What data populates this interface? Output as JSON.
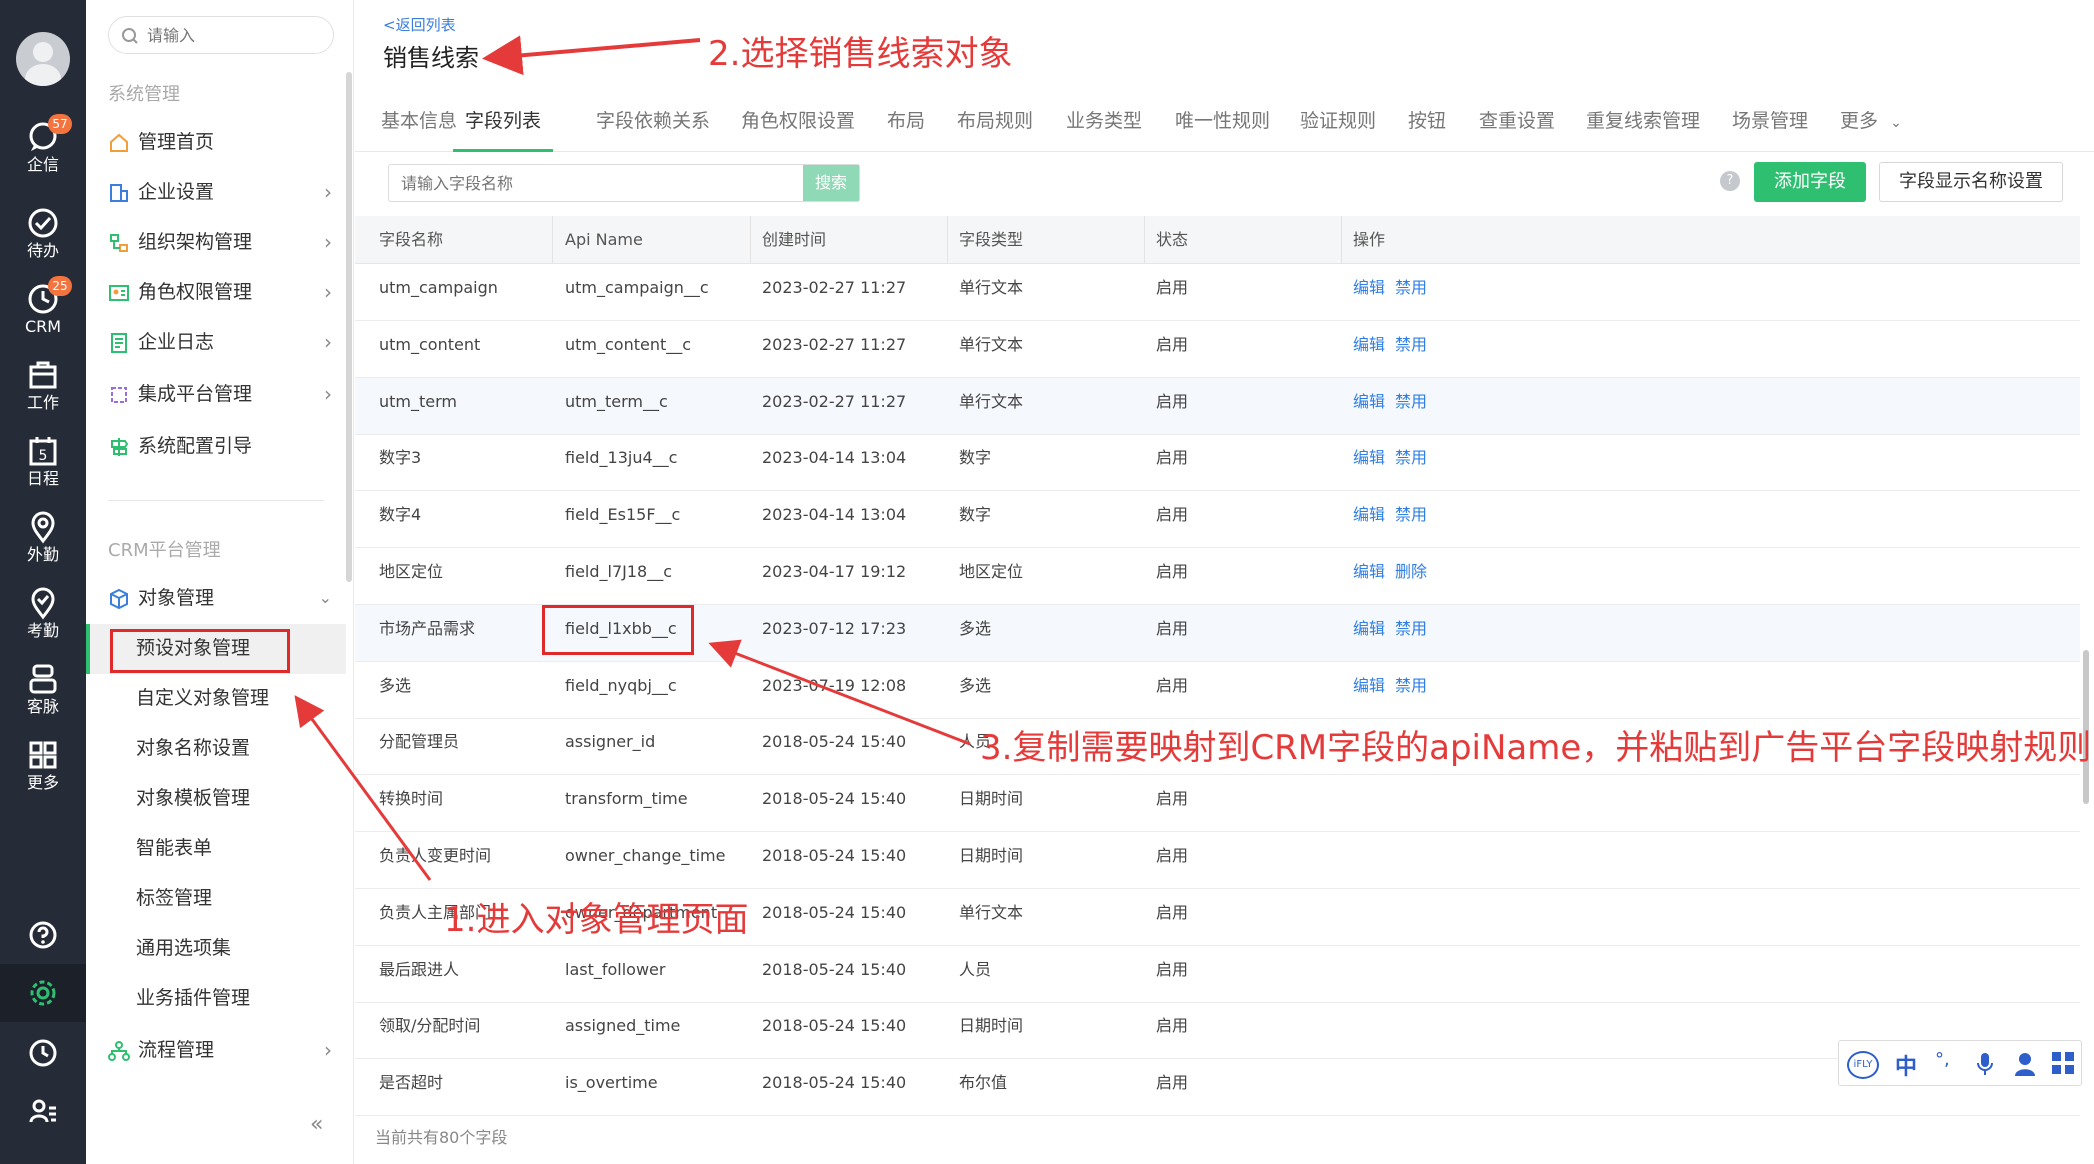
{
  "rail": {
    "items": [
      {
        "label": "企信",
        "icon": "chat-icon",
        "badge": "57"
      },
      {
        "label": "待办",
        "icon": "check-circle-icon",
        "badge": ""
      },
      {
        "label": "CRM",
        "icon": "crm-clock-icon",
        "badge": "25"
      },
      {
        "label": "工作",
        "icon": "briefcase-icon",
        "badge": ""
      },
      {
        "label": "日程",
        "icon": "calendar-icon",
        "badge": ""
      },
      {
        "label": "外勤",
        "icon": "location-icon",
        "badge": ""
      },
      {
        "label": "考勤",
        "icon": "attendance-icon",
        "badge": ""
      },
      {
        "label": "客脉",
        "icon": "contacts-icon",
        "badge": ""
      },
      {
        "label": "更多",
        "icon": "grid-icon",
        "badge": ""
      }
    ],
    "bottom": [
      "help-icon",
      "settings-icon",
      "history-icon",
      "user-list-icon"
    ]
  },
  "menu": {
    "search_placeholder": "请输入",
    "group_system": "系统管理",
    "system_items": [
      {
        "label": "管理首页",
        "icon": "home-icon",
        "arrow": ""
      },
      {
        "label": "企业设置",
        "icon": "enterprise-icon",
        "arrow": "›"
      },
      {
        "label": "组织架构管理",
        "icon": "org-icon",
        "arrow": "›"
      },
      {
        "label": "角色权限管理",
        "icon": "role-icon",
        "arrow": "›"
      },
      {
        "label": "企业日志",
        "icon": "log-icon",
        "arrow": "›"
      },
      {
        "label": "集成平台管理",
        "icon": "integration-icon",
        "arrow": "›"
      },
      {
        "label": "系统配置引导",
        "icon": "guide-icon",
        "arrow": ""
      }
    ],
    "group_crm": "CRM平台管理",
    "object_mgmt": "对象管理",
    "object_sub": [
      "预设对象管理",
      "自定义对象管理",
      "对象名称设置",
      "对象模板管理",
      "智能表单",
      "标签管理",
      "通用选项集",
      "业务插件管理"
    ],
    "process_mgmt": "流程管理",
    "collapse": "«"
  },
  "page": {
    "back": "<返回列表",
    "title": "销售线索",
    "tabs": [
      "基本信息",
      "字段列表",
      "字段依赖关系",
      "角色权限设置",
      "布局",
      "布局规则",
      "业务类型",
      "唯一性规则",
      "验证规则",
      "按钮",
      "查重设置",
      "重复线索管理",
      "场景管理",
      "更多"
    ],
    "active_tab": "字段列表",
    "search_placeholder": "请输入字段名称",
    "search_button": "搜索",
    "help": "?",
    "add_button": "添加字段",
    "name_setting_button": "字段显示名称设置",
    "footer": "当前共有80个字段"
  },
  "table": {
    "columns": [
      "字段名称",
      "Api Name",
      "创建时间",
      "字段类型",
      "状态",
      "操作"
    ],
    "rows": [
      {
        "name": "utm_campaign",
        "api": "utm_campaign__c",
        "time": "2023-02-27 11:27",
        "type": "单行文本",
        "status": "启用",
        "op1": "编辑",
        "op2": "禁用"
      },
      {
        "name": "utm_content",
        "api": "utm_content__c",
        "time": "2023-02-27 11:27",
        "type": "单行文本",
        "status": "启用",
        "op1": "编辑",
        "op2": "禁用"
      },
      {
        "name": "utm_term",
        "api": "utm_term__c",
        "time": "2023-02-27 11:27",
        "type": "单行文本",
        "status": "启用",
        "op1": "编辑",
        "op2": "禁用"
      },
      {
        "name": "数字3",
        "api": "field_13ju4__c",
        "time": "2023-04-14 13:04",
        "type": "数字",
        "status": "启用",
        "op1": "编辑",
        "op2": "禁用"
      },
      {
        "name": "数字4",
        "api": "field_Es15F__c",
        "time": "2023-04-14 13:04",
        "type": "数字",
        "status": "启用",
        "op1": "编辑",
        "op2": "禁用"
      },
      {
        "name": "地区定位",
        "api": "field_l7J18__c",
        "time": "2023-04-17 19:12",
        "type": "地区定位",
        "status": "启用",
        "op1": "编辑",
        "op2": "删除"
      },
      {
        "name": "市场产品需求",
        "api": "field_l1xbb__c",
        "time": "2023-07-12 17:23",
        "type": "多选",
        "status": "启用",
        "op1": "编辑",
        "op2": "禁用"
      },
      {
        "name": "多选",
        "api": "field_nyqbj__c",
        "time": "2023-07-19 12:08",
        "type": "多选",
        "status": "启用",
        "op1": "编辑",
        "op2": "禁用"
      },
      {
        "name": "分配管理员",
        "api": "assigner_id",
        "time": "2018-05-24 15:40",
        "type": "人员",
        "status": "",
        "op1": "",
        "op2": ""
      },
      {
        "name": "转换时间",
        "api": "transform_time",
        "time": "2018-05-24 15:40",
        "type": "日期时间",
        "status": "启用",
        "op1": "",
        "op2": ""
      },
      {
        "name": "负责人变更时间",
        "api": "owner_change_time",
        "time": "2018-05-24 15:40",
        "type": "日期时间",
        "status": "启用",
        "op1": "",
        "op2": ""
      },
      {
        "name": "负责人主属部门",
        "api": "owner_department",
        "time": "2018-05-24 15:40",
        "type": "单行文本",
        "status": "启用",
        "op1": "",
        "op2": ""
      },
      {
        "name": "最后跟进人",
        "api": "last_follower",
        "time": "2018-05-24 15:40",
        "type": "人员",
        "status": "启用",
        "op1": "",
        "op2": ""
      },
      {
        "name": "领取/分配时间",
        "api": "assigned_time",
        "time": "2018-05-24 15:40",
        "type": "日期时间",
        "status": "启用",
        "op1": "",
        "op2": ""
      },
      {
        "name": "是否超时",
        "api": "is_overtime",
        "time": "2018-05-24 15:40",
        "type": "布尔值",
        "status": "启用",
        "op1": "",
        "op2": ""
      }
    ]
  },
  "ime": [
    "iFLY",
    "中",
    "°,",
    "mic-icon",
    "user-icon",
    "apps-icon"
  ],
  "annotations": {
    "step1": "1.进入对象管理页面",
    "step2": "2.选择销售线索对象",
    "step3": "3.复制需要映射到CRM字段的apiName，并粘贴到广告平台字段映射规则中",
    "color": "#e53a3a"
  }
}
